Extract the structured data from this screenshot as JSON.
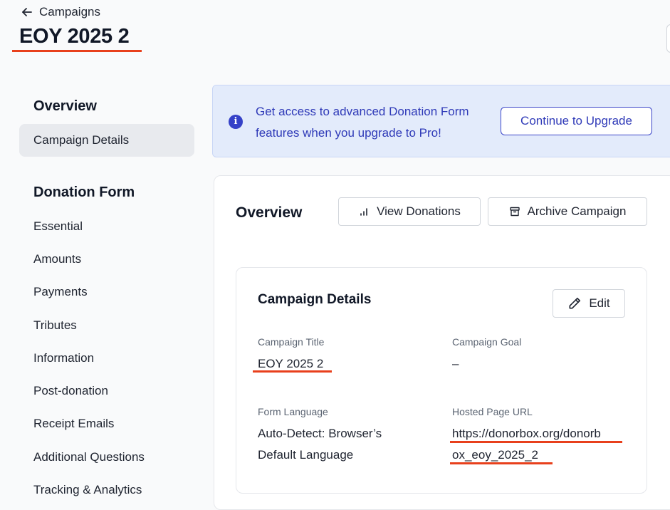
{
  "header": {
    "back_label": "Campaigns",
    "title": "EOY 2025 2"
  },
  "sidebar": {
    "overview_heading": "Overview",
    "overview_items": [
      {
        "label": "Campaign Details",
        "active": true
      }
    ],
    "donation_form_heading": "Donation Form",
    "donation_form_items": [
      {
        "label": "Essential"
      },
      {
        "label": "Amounts"
      },
      {
        "label": "Payments"
      },
      {
        "label": "Tributes"
      },
      {
        "label": "Information"
      },
      {
        "label": "Post-donation"
      },
      {
        "label": "Receipt Emails"
      },
      {
        "label": "Additional Questions"
      },
      {
        "label": "Tracking & Analytics"
      }
    ]
  },
  "banner": {
    "message": "Get access to advanced Donation Form features when you upgrade to Pro!",
    "button_label": "Continue to Upgrade",
    "icon": "info-icon"
  },
  "overview": {
    "title": "Overview",
    "view_donations_label": "View Donations",
    "archive_label": "Archive Campaign"
  },
  "campaign_details": {
    "title": "Campaign Details",
    "edit_label": "Edit",
    "fields": {
      "campaign_title_label": "Campaign Title",
      "campaign_title_value": "EOY 2025 2",
      "campaign_goal_label": "Campaign Goal",
      "campaign_goal_value": "–",
      "form_language_label": "Form Language",
      "form_language_line1": "Auto-Detect: Browser’s",
      "form_language_line2": "Default Language",
      "hosted_url_label": "Hosted Page URL",
      "hosted_url_line1": "https://donorbox.org/donorb",
      "hosted_url_line2": "ox_eoy_2025_2"
    }
  },
  "colors": {
    "accent": "#2f3ab8",
    "banner_bg": "#e3ebfb",
    "annotation_red": "#e8401c",
    "active_item_bg": "#e8eaee"
  }
}
